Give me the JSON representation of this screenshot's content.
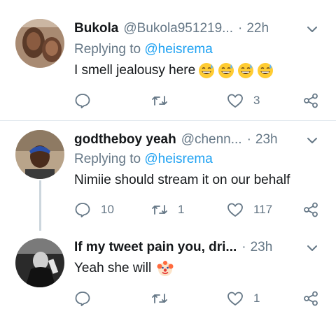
{
  "tweets": [
    {
      "name": "Bukola",
      "handle": "@Bukola951219...",
      "dot": "·",
      "time": "22h",
      "replying_prefix": "Replying to",
      "replying_to": "@heisrema",
      "text": "I smell jealousy here",
      "emoji": [
        "grinning-sweat-emoji",
        "grinning-sweat-emoji",
        "grinning-sweat-emoji",
        "grinning-sweat-emoji"
      ],
      "counts": {
        "replies": "",
        "retweets": "",
        "likes": "3"
      }
    },
    {
      "name": "godtheboy yeah",
      "handle": "@chenn...",
      "dot": "·",
      "time": "23h",
      "replying_prefix": "Replying to",
      "replying_to": "@heisrema",
      "text": "Nimiie should stream it on our behalf",
      "emoji": [],
      "counts": {
        "replies": "10",
        "retweets": "1",
        "likes": "117"
      }
    },
    {
      "name": "If my tweet pain you, dri...",
      "handle": "",
      "dot": "·",
      "time": "23h",
      "replying_prefix": "",
      "replying_to": "",
      "text": "Yeah she will",
      "emoji": [
        "clown-face-emoji"
      ],
      "counts": {
        "replies": "",
        "retweets": "",
        "likes": "1"
      }
    }
  ],
  "colors": {
    "text": "#14171a",
    "secondary": "#657786",
    "link": "#1da1f2",
    "divider": "#e1e8ed"
  }
}
